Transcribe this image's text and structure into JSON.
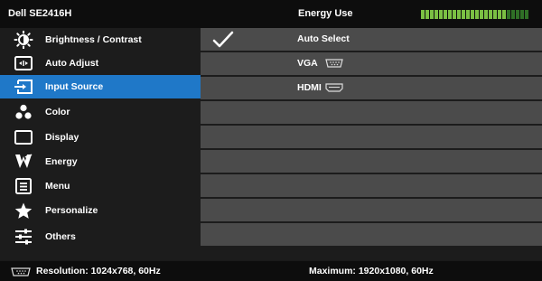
{
  "header": {
    "model": "Dell SE2416H",
    "energy_label": "Energy Use",
    "energy_level": 0.79,
    "energy_on_color": "#7bc043",
    "energy_off_color": "#2f6f26"
  },
  "menu": {
    "accent_color": "#1f78c8",
    "items": [
      {
        "label": "Brightness / Contrast",
        "icon": "brightness-icon",
        "active": false
      },
      {
        "label": "Auto Adjust",
        "icon": "auto-adjust-icon",
        "active": false
      },
      {
        "label": "Input Source",
        "icon": "input-source-icon",
        "active": true
      },
      {
        "label": "Color",
        "icon": "color-icon",
        "active": false
      },
      {
        "label": "Display",
        "icon": "display-icon",
        "active": false
      },
      {
        "label": "Energy",
        "icon": "energy-icon",
        "active": false
      },
      {
        "label": "Menu",
        "icon": "menu-icon",
        "active": false
      },
      {
        "label": "Personalize",
        "icon": "star-icon",
        "active": false
      },
      {
        "label": "Others",
        "icon": "others-icon",
        "active": false
      }
    ]
  },
  "options": {
    "rows": [
      {
        "label": "Auto Select",
        "checked": true,
        "icon": ""
      },
      {
        "label": "VGA",
        "checked": false,
        "icon": "vga-port-icon"
      },
      {
        "label": "HDMI",
        "checked": false,
        "icon": "hdmi-port-icon"
      },
      {
        "label": "",
        "checked": false,
        "icon": ""
      },
      {
        "label": "",
        "checked": false,
        "icon": ""
      },
      {
        "label": "",
        "checked": false,
        "icon": ""
      },
      {
        "label": "",
        "checked": false,
        "icon": ""
      },
      {
        "label": "",
        "checked": false,
        "icon": ""
      },
      {
        "label": "",
        "checked": false,
        "icon": ""
      }
    ]
  },
  "footer": {
    "resolution": "Resolution: 1024x768, 60Hz",
    "maximum": "Maximum: 1920x1080, 60Hz"
  }
}
